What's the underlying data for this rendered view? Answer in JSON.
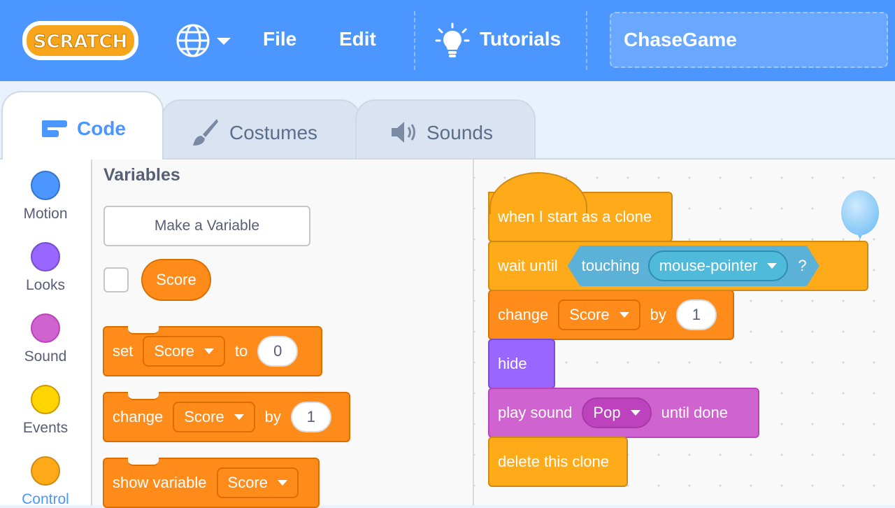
{
  "menubar": {
    "logo_text": "SCRATCH",
    "file_label": "File",
    "edit_label": "Edit",
    "tutorials_label": "Tutorials",
    "project_title": "ChaseGame"
  },
  "tabs": [
    {
      "label": "Code",
      "icon": "code-icon",
      "active": true
    },
    {
      "label": "Costumes",
      "icon": "brush-icon",
      "active": false
    },
    {
      "label": "Sounds",
      "icon": "speaker-icon",
      "active": false
    }
  ],
  "categories": [
    {
      "label": "Motion",
      "color": "#4c97ff"
    },
    {
      "label": "Looks",
      "color": "#9966ff"
    },
    {
      "label": "Sound",
      "color": "#cf63cf"
    },
    {
      "label": "Events",
      "color": "#ffd500"
    },
    {
      "label": "Control",
      "color": "#ffab19",
      "selected": true
    }
  ],
  "palette": {
    "heading": "Variables",
    "make_variable": "Make a Variable",
    "variable_reporter": "Score",
    "set_block": {
      "label": "set",
      "var": "Score",
      "to": "to",
      "value": "0"
    },
    "change_block": {
      "label": "change",
      "var": "Score",
      "by": "by",
      "value": "1"
    },
    "show_block": {
      "label": "show variable",
      "var": "Score"
    }
  },
  "script": {
    "hat": "when I start as a clone",
    "wait": {
      "label": "wait until",
      "touching": "touching",
      "target": "mouse-pointer",
      "q": "?"
    },
    "change": {
      "label": "change",
      "var": "Score",
      "by": "by",
      "value": "1"
    },
    "hide": "hide",
    "play_sound": {
      "label": "play sound",
      "sound": "Pop",
      "suffix": "until done"
    },
    "delete": "delete this clone"
  },
  "colors": {
    "menubar": "#4c97ff",
    "variables": "#ff8c1a",
    "control": "#ffab19",
    "looks": "#9966ff",
    "sound": "#cf63cf",
    "sensing": "#5cb1d6"
  }
}
